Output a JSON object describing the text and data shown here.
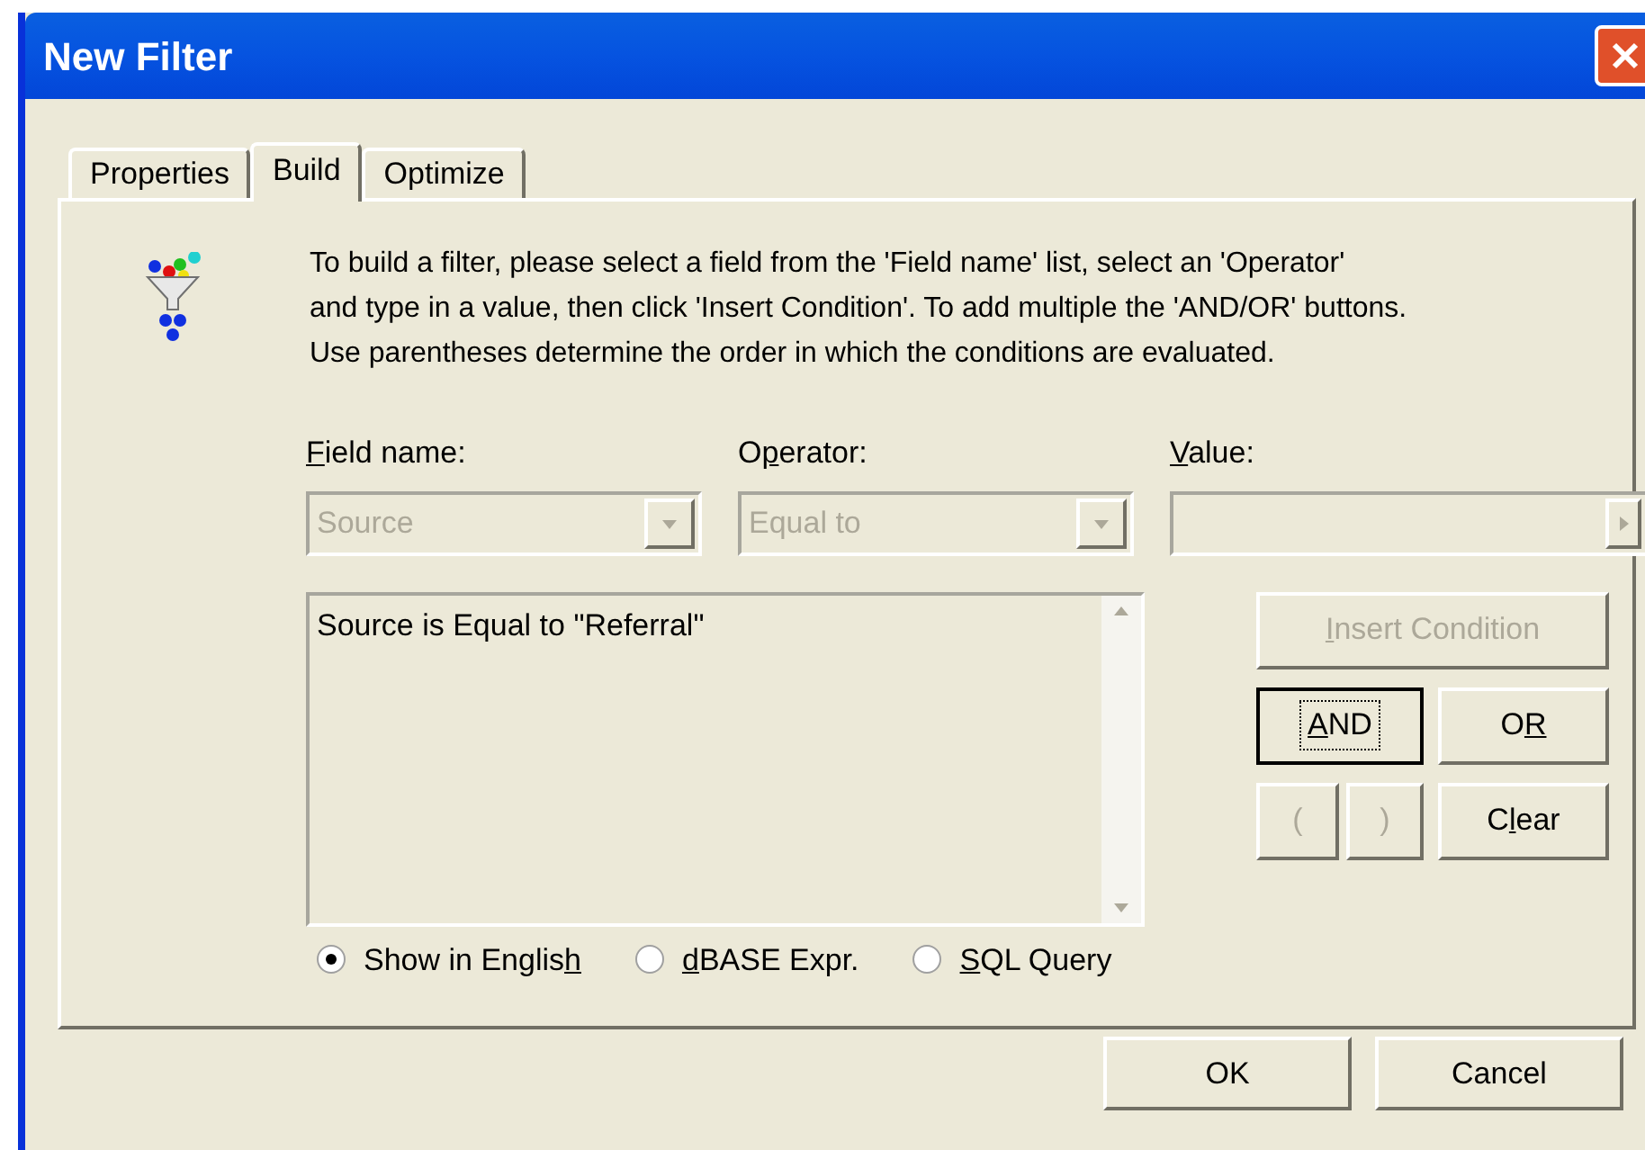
{
  "window": {
    "title": "New Filter"
  },
  "tabs": [
    {
      "label": "Properties",
      "selected": false
    },
    {
      "label": "Build",
      "selected": true
    },
    {
      "label": "Optimize",
      "selected": false
    }
  ],
  "instructions": "To build a filter, please select a field from the 'Field name' list, select an 'Operator'  and type in a value, then click 'Insert Condition'. To add multiple the 'AND/OR' buttons.  Use parentheses determine the order in which the conditions are evaluated.",
  "fields": [
    {
      "kind": "combo",
      "access_key": "F",
      "label_end": "ield name:",
      "value": "Source",
      "disabled": true
    },
    {
      "kind": "combo",
      "label_start": "O",
      "access_key": "p",
      "label_end": "erator:",
      "value": "Equal to",
      "disabled": true
    },
    {
      "kind": "picker",
      "access_key": "V",
      "label_end": "alue:",
      "disabled": true
    }
  ],
  "conditions": {
    "text": "Source is Equal to \"Referral\""
  },
  "condition_buttons": [
    {
      "access_key": "I",
      "label_end": "nsert Condition",
      "disabled": true,
      "focused": false
    },
    {
      "access_key": "A",
      "label_end": "ND",
      "disabled": false,
      "focused": true
    },
    {
      "label_start": "O",
      "access_key": "R",
      "disabled": false,
      "focused": false
    },
    {
      "label": "(",
      "disabled": true,
      "focused": false
    },
    {
      "label": ")",
      "disabled": true,
      "focused": false
    },
    {
      "label_start": "C",
      "access_key": "l",
      "label_end": "ear",
      "disabled": false,
      "focused": false
    }
  ],
  "display_modes": [
    {
      "label_start": "Show in Englis",
      "access_key": "h",
      "selected": true
    },
    {
      "access_key": "d",
      "label_end": "BASE Expr.",
      "selected": false
    },
    {
      "access_key": "S",
      "label_end": "QL Query",
      "selected": false
    }
  ],
  "buttons": [
    {
      "label": "OK"
    },
    {
      "label": "Cancel"
    }
  ]
}
